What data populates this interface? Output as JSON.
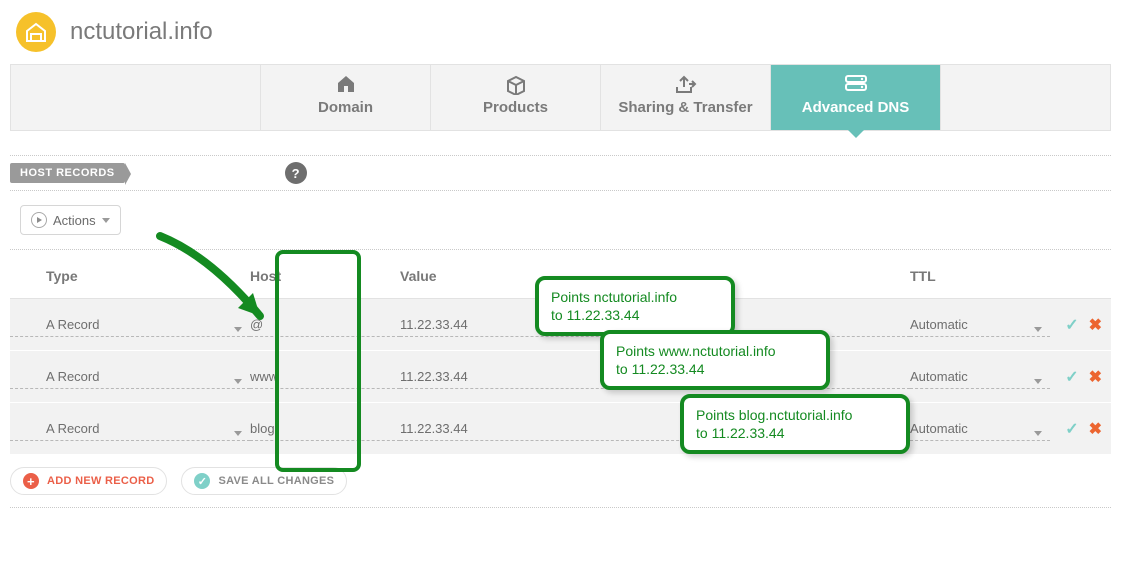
{
  "header": {
    "domain": "nctutorial.info"
  },
  "tabs": [
    {
      "label": "Domain"
    },
    {
      "label": "Products"
    },
    {
      "label": "Sharing & Transfer"
    },
    {
      "label": "Advanced DNS",
      "active": true
    }
  ],
  "section": {
    "label": "HOST RECORDS"
  },
  "actions_button": "Actions",
  "columns": {
    "type": "Type",
    "host": "Host",
    "value": "Value",
    "ttl": "TTL"
  },
  "records": [
    {
      "type": "A Record",
      "host": "@",
      "value": "11.22.33.44",
      "ttl": "Automatic"
    },
    {
      "type": "A Record",
      "host": "www",
      "value": "11.22.33.44",
      "ttl": "Automatic"
    },
    {
      "type": "A Record",
      "host": "blog",
      "value": "11.22.33.44",
      "ttl": "Automatic"
    }
  ],
  "buttons": {
    "add": "ADD NEW RECORD",
    "save": "SAVE ALL CHANGES"
  },
  "annotations": {
    "n1a": "Points nctutorial.info",
    "n1b": "to 11.22.33.44",
    "n2a": "Points www.nctutorial.info",
    "n2b": "to 11.22.33.44",
    "n3a": "Points blog.nctutorial.info",
    "n3b": "to 11.22.33.44"
  }
}
